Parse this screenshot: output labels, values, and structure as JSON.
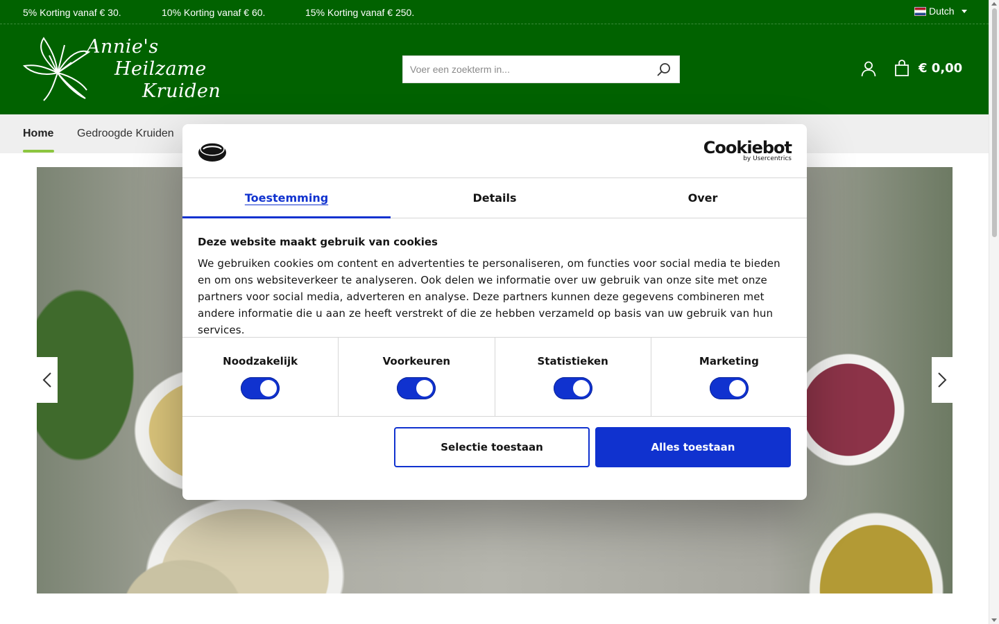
{
  "promo": {
    "items": [
      "5% Korting vanaf € 30.",
      "10% Korting vanaf € 60.",
      "15% Korting vanaf € 250."
    ],
    "language": "Dutch"
  },
  "header": {
    "logo_lines": [
      "Annie's",
      "Heilzame",
      "Kruiden"
    ],
    "search_placeholder": "Voer een zoekterm in...",
    "cart_total": "€ 0,00"
  },
  "nav": {
    "items": [
      "Home",
      "Gedroogde Kruiden"
    ]
  },
  "cookie": {
    "brand_name": "Cookiebot",
    "brand_sub": "by Usercentrics",
    "tabs": [
      "Toestemming",
      "Details",
      "Over"
    ],
    "title": "Deze website maakt gebruik van cookies",
    "text": "We gebruiken cookies om content en advertenties te personaliseren, om functies voor social media te bieden en om ons websiteverkeer te analyseren. Ook delen we informatie over uw gebruik van onze site met onze partners voor social media, adverteren en analyse. Deze partners kunnen deze gegevens combineren met andere informatie die u aan ze heeft verstrekt of die ze hebben verzameld op basis van uw gebruik van hun services.",
    "toggles": [
      {
        "label": "Noodzakelijk",
        "on": true
      },
      {
        "label": "Voorkeuren",
        "on": true
      },
      {
        "label": "Statistieken",
        "on": true
      },
      {
        "label": "Marketing",
        "on": true
      }
    ],
    "btn_selection": "Selectie toestaan",
    "btn_all": "Alles toestaan"
  },
  "colors": {
    "header_green": "#016200",
    "nav_accent": "#8cc63f",
    "cookie_blue": "#1032cf"
  }
}
